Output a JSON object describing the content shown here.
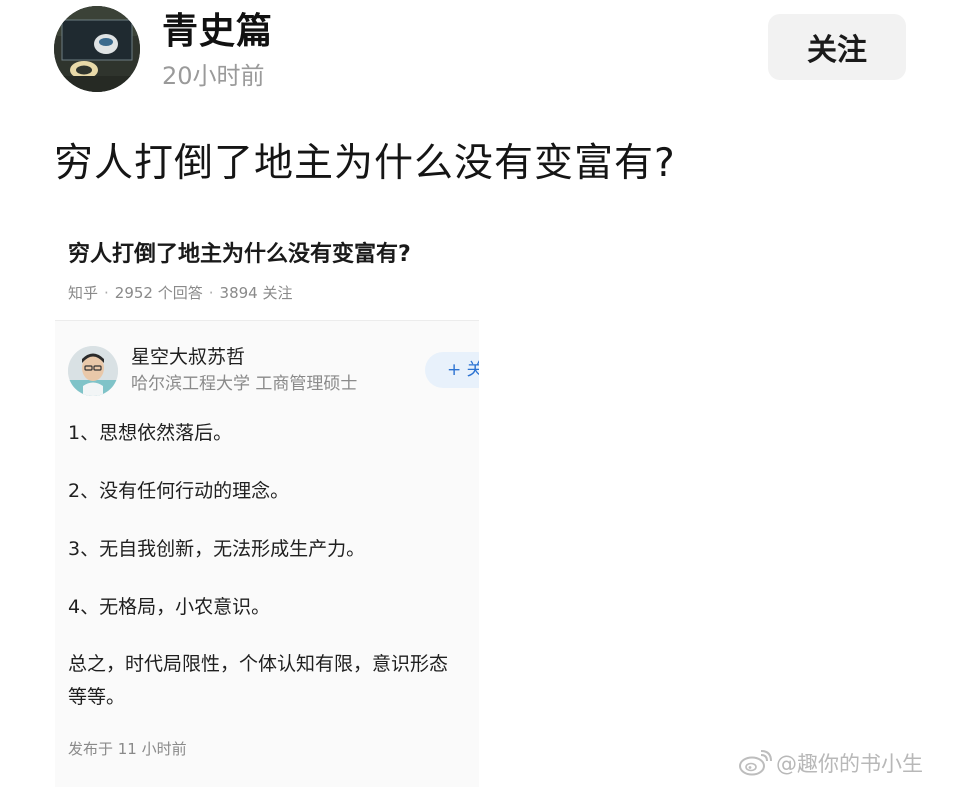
{
  "header": {
    "author_name": "青史篇",
    "post_time": "20小时前",
    "follow_label": "关注"
  },
  "post": {
    "title": "穷人打倒了地主为什么没有变富有?"
  },
  "embed": {
    "question_title": "穷人打倒了地主为什么没有变富有?",
    "source": "知乎",
    "answers_count": "2952 个回答",
    "followers_count": "3894 关注",
    "answerer_name": "星空大叔苏哲",
    "answerer_bio": "哈尔滨工程大学 工商管理硕士",
    "follow_label": "+ 关",
    "answer_lines": [
      "1、思想依然落后。",
      "2、没有任何行动的理念。",
      "3、无自我创新，无法形成生产力。",
      "4、无格局，小农意识。",
      "总之，时代局限性，个体认知有限，意识形态",
      "等等。"
    ],
    "publish_time": "发布于  11 小时前"
  },
  "watermark": {
    "text": "@趣你的书小生",
    "icon": "weibo-icon"
  },
  "colors": {
    "follow_bg": "#f2f2f2",
    "muted_text": "#9a9a9a",
    "embed_follow_text": "#2c73d2",
    "embed_follow_bg": "#e8f1fb"
  }
}
